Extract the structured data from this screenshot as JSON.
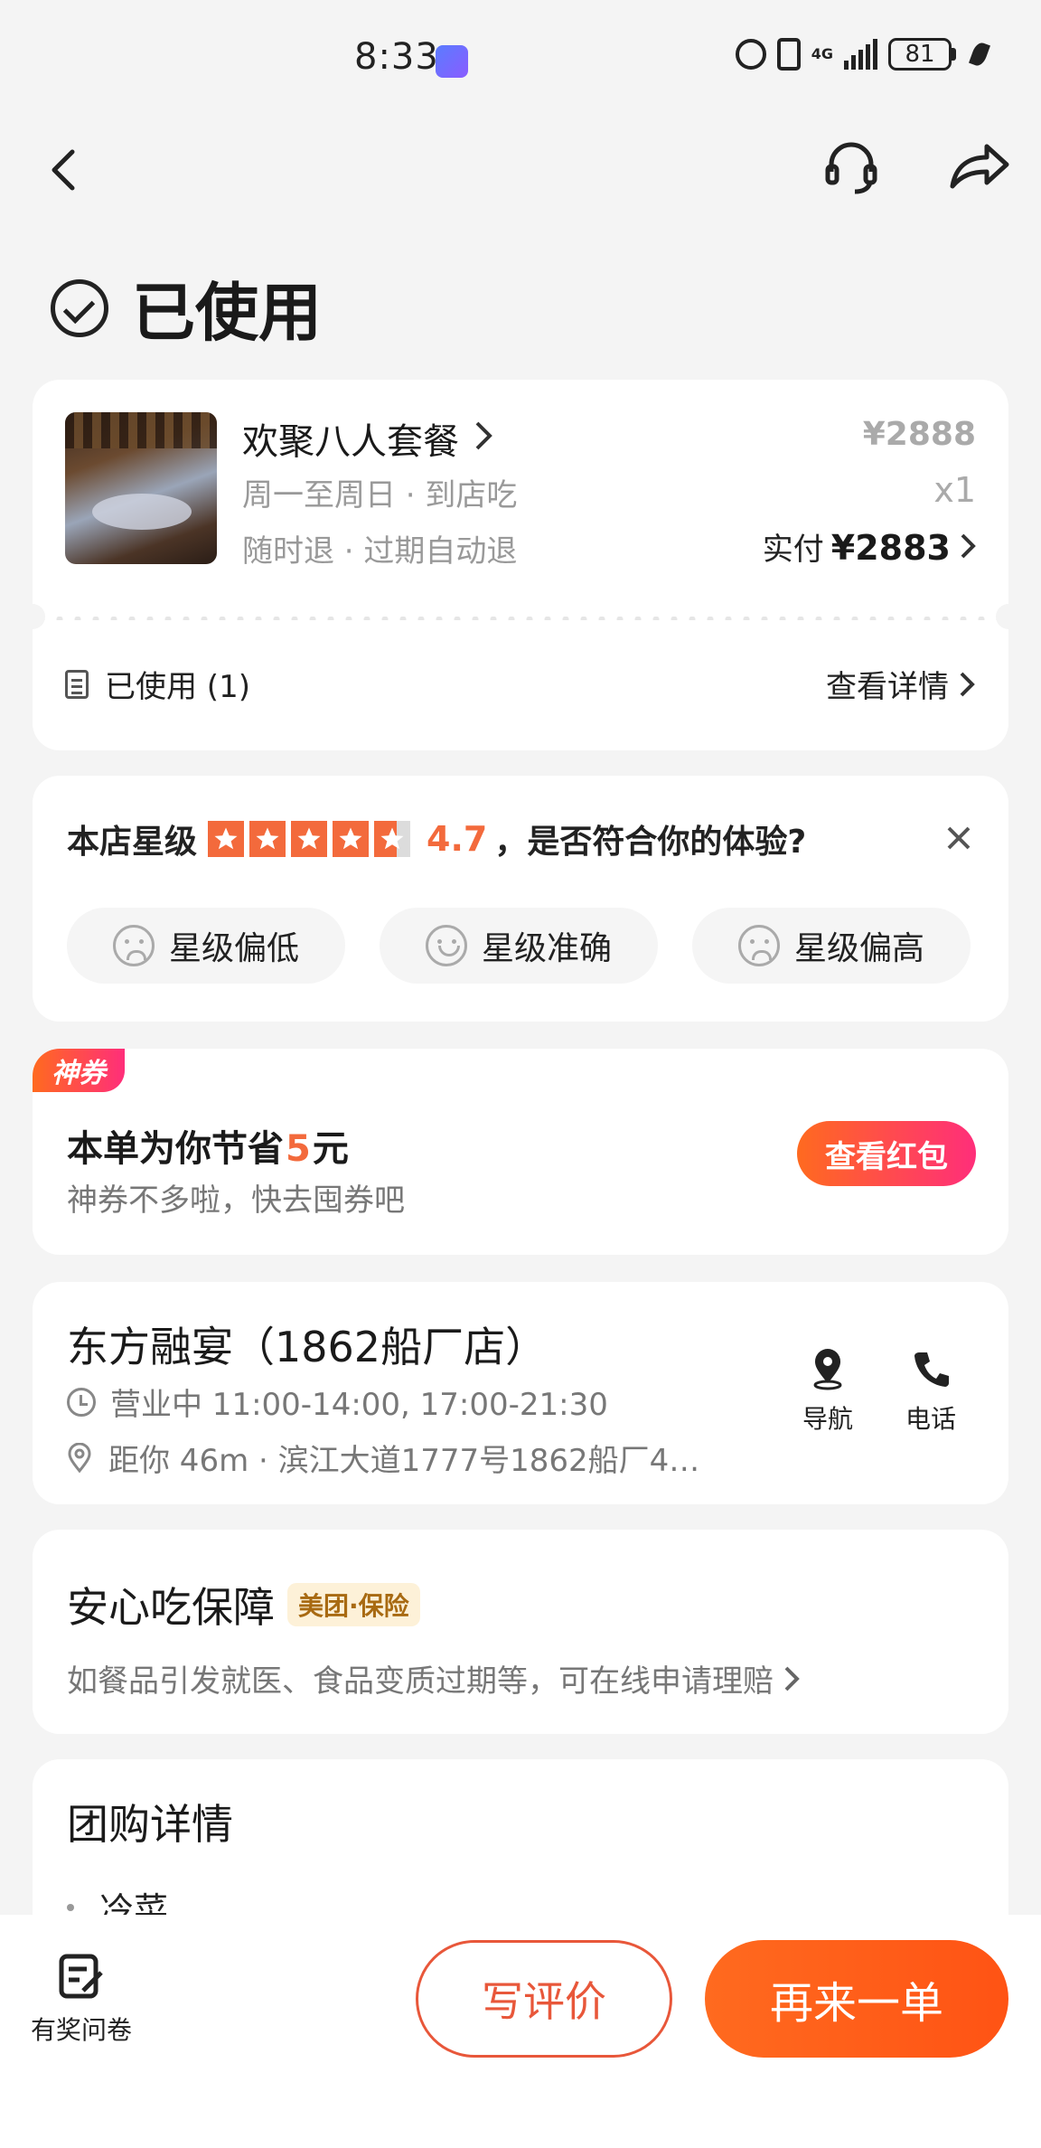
{
  "status_bar": {
    "time": "8:33",
    "network": "4G",
    "battery": "81"
  },
  "header": {
    "status_title": "已使用"
  },
  "order": {
    "deal_name": "欢聚八人套餐",
    "tag1": "周一至周日 · 到店吃",
    "tag2": "随时退 · 过期自动退",
    "original_price": "¥2888",
    "quantity": "x1",
    "paid_label": "实付",
    "paid_amount": "¥2883",
    "used_label": "已使用 (1)",
    "detail_link": "查看详情"
  },
  "rating": {
    "label": "本店星级",
    "score": "4.7",
    "stars": 4.7,
    "question": "，是否符合你的体验?",
    "options": [
      "星级偏低",
      "星级准确",
      "星级偏高"
    ]
  },
  "coupon": {
    "tag": "神券",
    "save_prefix": "本单为你节省",
    "save_amount": "5",
    "save_suffix": "元",
    "subtitle": "神券不多啦，快去囤券吧",
    "button": "查看红包"
  },
  "store": {
    "name": "东方融宴（1862船厂店）",
    "hours": "营业中 11:00-14:00, 17:00-21:30",
    "address": "距你 46m ·  滨江大道1777号1862船厂4…",
    "nav_label": "导航",
    "call_label": "电话"
  },
  "guarantee": {
    "title": "安心吃保障",
    "badge": "美团·保险",
    "desc": "如餐品引发就医、食品变质过期等，可在线申请理赔"
  },
  "details": {
    "title": "团购详情",
    "first_item": "冷菜"
  },
  "bottom": {
    "survey_label": "有奖问卷",
    "review_button": "写评价",
    "reorder_button": "再来一单"
  },
  "colors": {
    "accent": "#f36a3c",
    "gradient_start": "#ff6a1f",
    "gradient_end": "#ff2e7a"
  }
}
